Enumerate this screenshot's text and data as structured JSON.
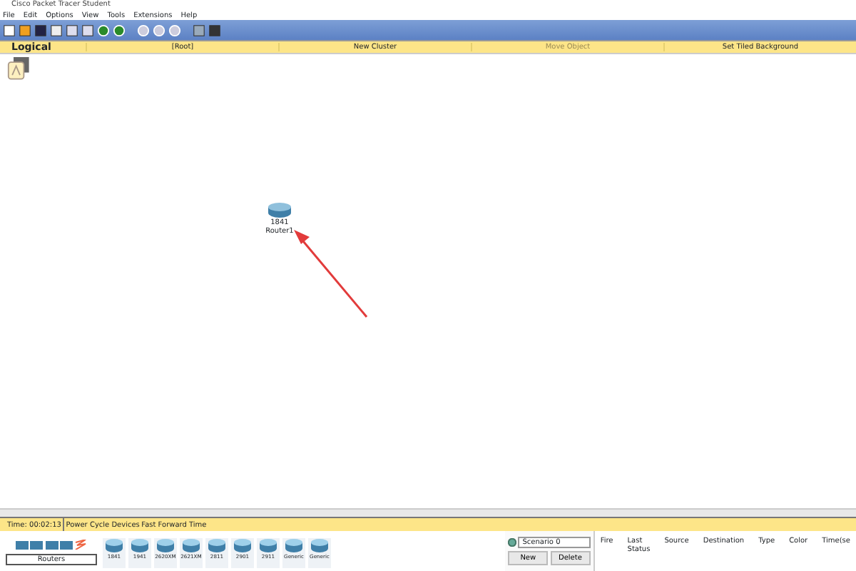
{
  "window": {
    "title": "Cisco Packet Tracer Student"
  },
  "menu": [
    "File",
    "Edit",
    "Options",
    "View",
    "Tools",
    "Extensions",
    "Help"
  ],
  "workspace_bar": {
    "mode": "Logical",
    "items": [
      {
        "label": "[Root]",
        "disabled": false
      },
      {
        "label": "New Cluster",
        "disabled": false
      },
      {
        "label": "Move Object",
        "disabled": true
      },
      {
        "label": "Set Tiled Background",
        "disabled": false
      }
    ]
  },
  "canvas": {
    "devices": [
      {
        "model": "1841",
        "name": "Router1"
      }
    ]
  },
  "status_bar": {
    "time": "Time: 00:02:13",
    "actions": [
      "Power Cycle Devices",
      "Fast Forward Time"
    ]
  },
  "device_palette": {
    "category": "Routers",
    "devices": [
      "1841",
      "1941",
      "2620XM",
      "2621XM",
      "2811",
      "2901",
      "2911",
      "Generic",
      "Generic"
    ]
  },
  "scenario": {
    "value": "Scenario 0",
    "buttons": [
      "New",
      "Delete"
    ]
  },
  "pdu_table": {
    "columns": [
      "Fire",
      "Last Status",
      "Source",
      "Destination",
      "Type",
      "Color",
      "Time(se"
    ]
  }
}
